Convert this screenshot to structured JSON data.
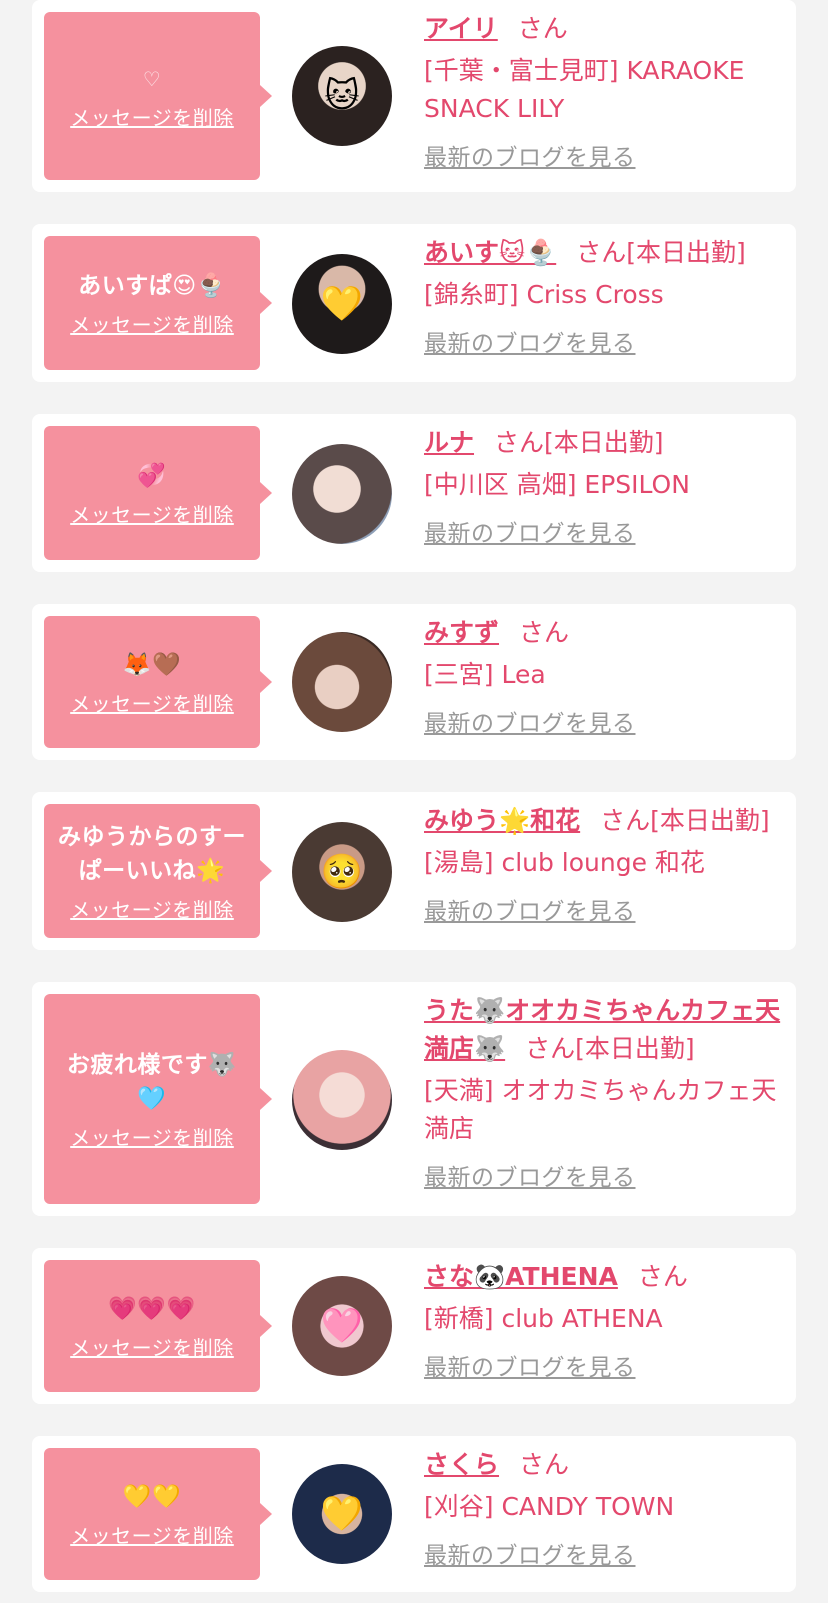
{
  "delete_label": "メッセージを削除",
  "blog_label": "最新のブログを見る",
  "san_label": "さん",
  "working_label": "[本日出勤]",
  "items": [
    {
      "message": "♡",
      "name": "アイリ",
      "working": false,
      "shop": "[千葉・富士見町] KARAOKE SNACK LILY"
    },
    {
      "message": "あいすぱ😍🍨",
      "name": "あいす🐱🍨",
      "working": true,
      "shop": "[錦糸町] Criss Cross"
    },
    {
      "message": "💞",
      "name": "ルナ",
      "working": true,
      "shop": "[中川区 高畑] EPSILON"
    },
    {
      "message": "🦊🤎",
      "name": "みすず",
      "working": false,
      "shop": "[三宮] Lea"
    },
    {
      "message": "みゆうからのすーぱーいいね🌟",
      "name": "みゆう🌟和花",
      "working": true,
      "shop": "[湯島] club lounge 和花"
    },
    {
      "message": "お疲れ様です🐺🩵",
      "name": "うた🐺オオカミちゃんカフェ天満店🐺",
      "working": true,
      "shop": "[天満] オオカミちゃんカフェ天満店"
    },
    {
      "message": "💗💗💗",
      "name": "さな🐼ATHENA",
      "working": false,
      "shop": "[新橋] club ATHENA"
    },
    {
      "message": "💛💛",
      "name": "さくら",
      "working": false,
      "shop": "[刈谷] CANDY TOWN"
    }
  ]
}
